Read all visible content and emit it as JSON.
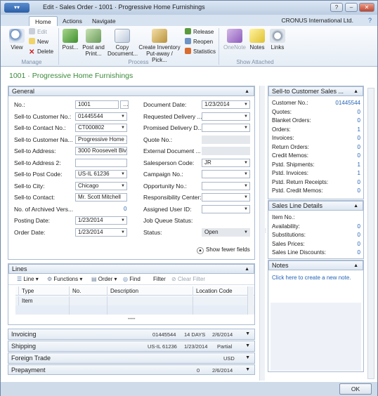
{
  "window": {
    "app_button": "▾▾",
    "title": "Edit - Sales Order - 1001 · Progressive Home Furnishings"
  },
  "ribbon_tabs": [
    "Home",
    "Actions",
    "Navigate"
  ],
  "company": "CRONUS International Ltd.",
  "ribbon": {
    "view": "View",
    "edit": "Edit",
    "new": "New",
    "delete": "Delete",
    "manage": "Manage",
    "post": "Post...",
    "post_print": "Post and Print...",
    "copy_doc": "Copy Document...",
    "create_inv": "Create Inventory Put-away / Pick...",
    "release": "Release",
    "reopen": "Reopen",
    "statistics": "Statistics",
    "process": "Process",
    "onenote": "OneNote",
    "notes": "Notes",
    "links": "Links",
    "show_attached": "Show Attached"
  },
  "page_title": "1001 · Progressive Home Furnishings",
  "general": {
    "header": "General",
    "left": [
      {
        "label": "No.:",
        "value": "1001"
      },
      {
        "label": "Sell-to Customer No.:",
        "value": "01445544"
      },
      {
        "label": "Sell-to Contact No.:",
        "value": "CT000802"
      },
      {
        "label": "Sell-to Customer Na...",
        "value": "Progressive Home ..."
      },
      {
        "label": "Sell-to Address:",
        "value": "3000 Roosevelt Blvd."
      },
      {
        "label": "Sell-to Address 2:",
        "value": ""
      },
      {
        "label": "Sell-to Post Code:",
        "value": "US-IL 61236"
      },
      {
        "label": "Sell-to City:",
        "value": "Chicago"
      },
      {
        "label": "Sell-to Contact:",
        "value": "Mr. Scott Mitchell"
      },
      {
        "label": "No. of Archived Vers...",
        "value": "0"
      },
      {
        "label": "Posting Date:",
        "value": "1/23/2014"
      },
      {
        "label": "Order Date:",
        "value": "1/23/2014"
      }
    ],
    "right": [
      {
        "label": "Document Date:",
        "value": "1/23/2014"
      },
      {
        "label": "Requested Delivery ...",
        "value": ""
      },
      {
        "label": "Promised Delivery D...",
        "value": ""
      },
      {
        "label": "Quote No.:",
        "value": ""
      },
      {
        "label": "External Document ...",
        "value": ""
      },
      {
        "label": "Salesperson Code:",
        "value": "JR"
      },
      {
        "label": "Campaign No.:",
        "value": ""
      },
      {
        "label": "Opportunity No.:",
        "value": ""
      },
      {
        "label": "Responsibility Center:",
        "value": ""
      },
      {
        "label": "Assigned User ID:",
        "value": ""
      },
      {
        "label": "Job Queue Status:",
        "value": ""
      },
      {
        "label": "Status:",
        "value": "Open"
      }
    ],
    "show_fewer": "Show fewer fields"
  },
  "lines": {
    "header": "Lines",
    "toolbar": [
      "Line",
      "Functions",
      "Order",
      "Find",
      "Filter",
      "Clear Filter"
    ],
    "columns": [
      "Type",
      "No.",
      "Description",
      "Location Code"
    ],
    "row1": "Item"
  },
  "collapsed": [
    {
      "label": "Invoicing",
      "summary": [
        "01445544",
        "14 DAYS",
        "2/6/2014"
      ]
    },
    {
      "label": "Shipping",
      "summary": [
        "US-IL 61236",
        "1/23/2014",
        "Partial"
      ]
    },
    {
      "label": "Foreign Trade",
      "summary": [
        "USD"
      ]
    },
    {
      "label": "Prepayment",
      "summary": [
        "0",
        "2/6/2014"
      ]
    }
  ],
  "factbox_customer": {
    "header": "Sell-to Customer Sales ...",
    "rows": [
      {
        "label": "Customer No.:",
        "value": "01445544"
      },
      {
        "label": "Quotes:",
        "value": "0"
      },
      {
        "label": "Blanket Orders:",
        "value": "0"
      },
      {
        "label": "Orders:",
        "value": "1"
      },
      {
        "label": "Invoices:",
        "value": "0"
      },
      {
        "label": "Return Orders:",
        "value": "0"
      },
      {
        "label": "Credit Memos:",
        "value": "0"
      },
      {
        "label": "Pstd. Shipments:",
        "value": "1"
      },
      {
        "label": "Pstd. Invoices:",
        "value": "1"
      },
      {
        "label": "Pstd. Return Receipts:",
        "value": "0"
      },
      {
        "label": "Pstd. Credit Memos:",
        "value": "0"
      }
    ]
  },
  "factbox_sales_line": {
    "header": "Sales Line Details",
    "rows": [
      {
        "label": "Item No.:",
        "value": ""
      },
      {
        "label": "Availability:",
        "value": "0"
      },
      {
        "label": "Substitutions:",
        "value": "0"
      },
      {
        "label": "Sales Prices:",
        "value": "0"
      },
      {
        "label": "Sales Line Discounts:",
        "value": "0"
      }
    ]
  },
  "factbox_notes": {
    "header": "Notes",
    "link": "Click here to create a new note."
  },
  "ok": "OK"
}
